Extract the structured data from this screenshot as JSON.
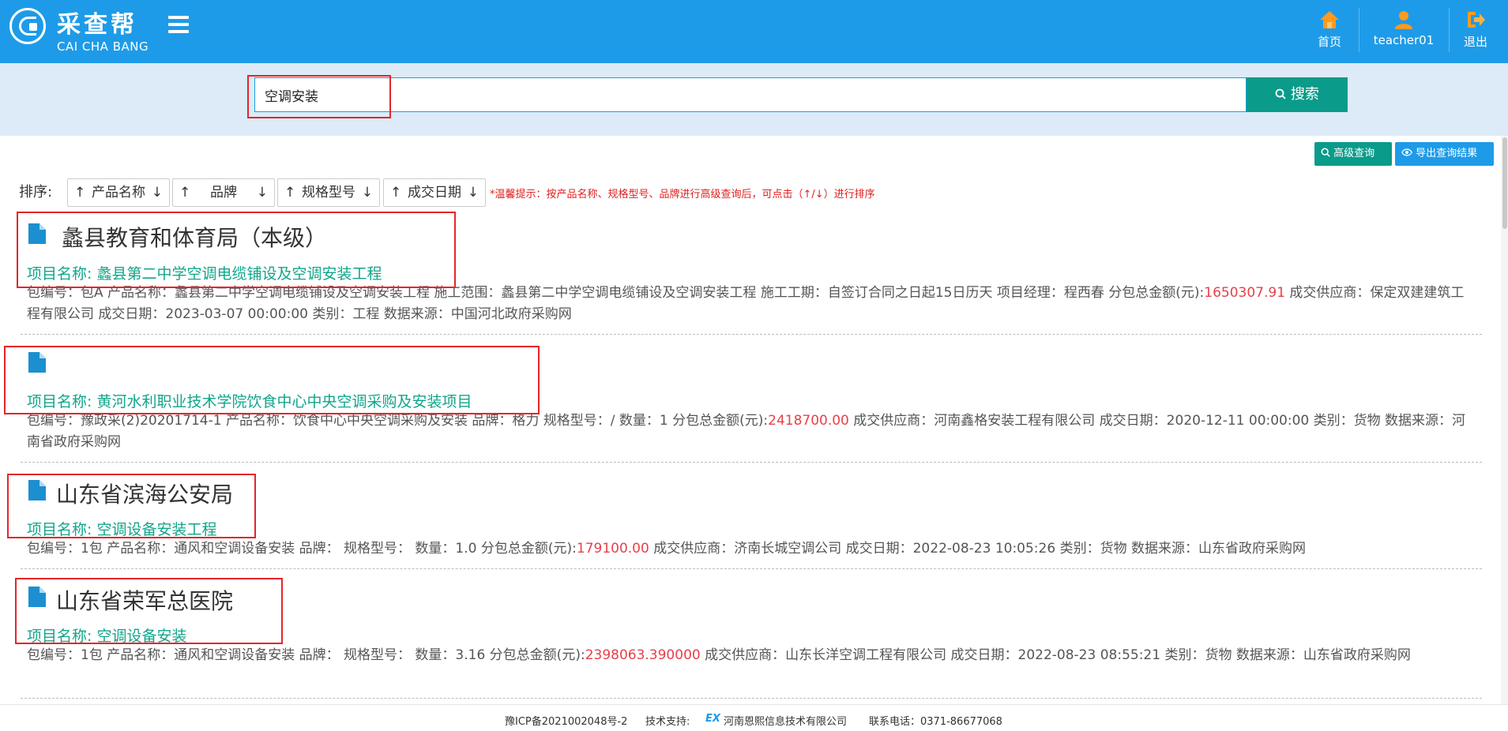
{
  "header": {
    "logo_cn": "采查帮",
    "logo_en": "CAI CHA BANG",
    "nav": {
      "home": "首页",
      "user": "teacher01",
      "logout": "退出"
    },
    "icons": [
      "home-icon",
      "user-icon",
      "logout-icon",
      "menu-icon"
    ]
  },
  "search": {
    "value": "空调安装",
    "button": "搜索"
  },
  "toolbar": {
    "advanced": "高级查询",
    "export": "导出查询结果"
  },
  "sort": {
    "label": "排序:",
    "fields": [
      "产品名称",
      "品牌",
      "规格型号",
      "成交日期"
    ],
    "hint": "*温馨提示：按产品名称、规格型号、品牌进行高级查询后，可点击（↑/↓）进行排序"
  },
  "results": [
    {
      "title": "蠡县教育和体育局（本级）",
      "project_label": "项目名称:",
      "project": "蠡县第二中学空调电缆铺设及空调安装工程",
      "detail_pre": "包编号：包A  产品名称：蠡县第二中学空调电缆铺设及空调安装工程  施工范围：蠡县第二中学空调电缆铺设及空调安装工程  施工工期：自签订合同之日起15日历天  项目经理：程西春  分包总金额(元):",
      "amount": "1650307.91",
      "detail_post": "  成交供应商：保定双建建筑工程有限公司  成交日期：2023-03-07 00:00:00  类别：工程  数据来源：中国河北政府采购网"
    },
    {
      "title": "",
      "project_label": "项目名称:",
      "project": "黄河水利职业技术学院饮食中心中央空调采购及安装项目",
      "detail_pre": "包编号：豫政采(2)20201714-1  产品名称：饮食中心中央空调采购及安装  品牌：格力  规格型号：/  数量：1  分包总金额(元):",
      "amount": "2418700.00",
      "detail_post": "  成交供应商：河南鑫格安装工程有限公司  成交日期：2020-12-11 00:00:00  类别：货物  数据来源：河南省政府采购网"
    },
    {
      "title": "山东省滨海公安局",
      "project_label": "项目名称:",
      "project": "空调设备安装工程",
      "detail_pre": "包编号：1包  产品名称：通风和空调设备安装  品牌：  规格型号：  数量：1.0  分包总金额(元):",
      "amount": "179100.00",
      "detail_post": "  成交供应商：济南长城空调公司  成交日期：2022-08-23 10:05:26  类别：货物  数据来源：山东省政府采购网"
    },
    {
      "title": "山东省荣军总医院",
      "project_label": "项目名称:",
      "project": "空调设备安装",
      "detail_pre": "包编号：1包  产品名称：通风和空调设备安装  品牌：  规格型号：  数量：3.16  分包总金额(元):",
      "amount": "2398063.390000",
      "detail_post": "  成交供应商：山东长洋空调工程有限公司  成交日期：2022-08-23 08:55:21  类别：货物  数据来源：山东省政府采购网"
    }
  ],
  "footer": {
    "icp": "豫ICP备2021002048号-2",
    "support_label": "技术支持:",
    "support_logo": "EX",
    "support_company": "河南恩熙信息技术有限公司",
    "phone": "联系电话：0371-86677068"
  },
  "colors": {
    "header_bg": "#1e9be8",
    "search_btn": "#0a9b8a",
    "advanced_btn": "#0a9b8a",
    "export_btn": "#1e9be8",
    "project_text": "#11a58a",
    "amount_text": "#e8404a",
    "highlight_box": "#e5252a"
  }
}
